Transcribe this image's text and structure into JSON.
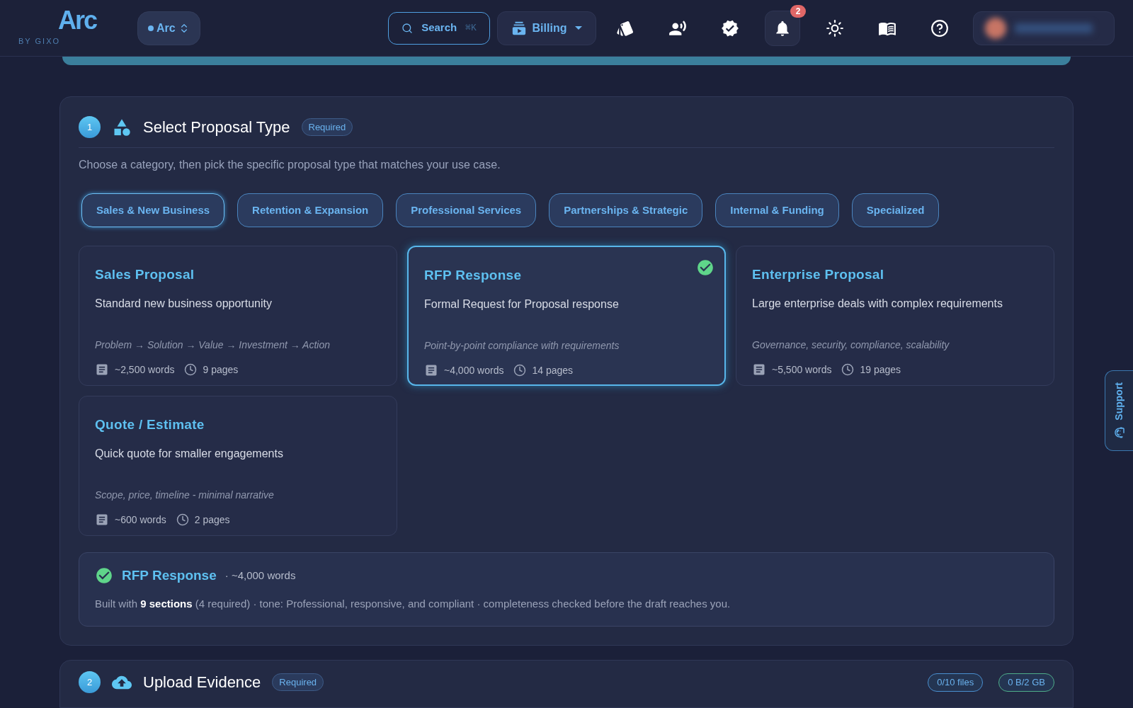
{
  "header": {
    "logo": {
      "title": "Arc",
      "subtitle": "BY GIXO"
    },
    "workspace": "Arc",
    "search": {
      "label": "Search",
      "shortcut": "⌘K"
    },
    "billing": "Billing",
    "icons": [
      {
        "kind": "cards"
      },
      {
        "kind": "voice"
      },
      {
        "kind": "verified"
      },
      {
        "kind": "bell",
        "badge": "2"
      },
      {
        "kind": "sun"
      },
      {
        "kind": "book"
      },
      {
        "kind": "help"
      }
    ]
  },
  "section1": {
    "number": "1",
    "title": "Select Proposal Type",
    "badge": "Required",
    "description": "Choose a category, then pick the specific proposal type that matches your use case.",
    "categories": [
      {
        "label": "Sales & New Business",
        "selected": true
      },
      {
        "label": "Retention & Expansion",
        "selected": false
      },
      {
        "label": "Professional Services",
        "selected": false
      },
      {
        "label": "Partnerships & Strategic",
        "selected": false
      },
      {
        "label": "Internal & Funding",
        "selected": false
      },
      {
        "label": "Specialized",
        "selected": false
      }
    ],
    "proposals": [
      {
        "title": "Sales Proposal",
        "description": "Standard new business opportunity",
        "structure": "Problem → Solution → Value → Investment → Action",
        "words": "~2,500 words",
        "pages": "9 pages",
        "selected": false
      },
      {
        "title": "RFP Response",
        "description": "Formal Request for Proposal response",
        "structure": "Point-by-point compliance with requirements",
        "words": "~4,000 words",
        "pages": "14 pages",
        "selected": true
      },
      {
        "title": "Enterprise Proposal",
        "description": "Large enterprise deals with complex requirements",
        "structure": "Governance, security, compliance, scalability",
        "words": "~5,500 words",
        "pages": "19 pages",
        "selected": false
      },
      {
        "title": "Quote / Estimate",
        "description": "Quick quote for smaller engagements",
        "structure": "Scope, price, timeline - minimal narrative",
        "words": "~600 words",
        "pages": "2 pages",
        "selected": false
      }
    ],
    "summary": {
      "title": "RFP Response",
      "words": "· ~4,000 words",
      "text": "Built with **9 sections** (4 required) · tone: Professional, responsive, and compliant · completeness checked before the draft reaches you."
    }
  },
  "section2": {
    "number": "2",
    "title": "Upload Evidence",
    "badge": "Required",
    "stats": [
      {
        "label": "0/10 files",
        "color": "#4a8fd0"
      },
      {
        "label": "0 B/2 GB",
        "color": "#4fae8a"
      }
    ]
  },
  "support": "Support"
}
